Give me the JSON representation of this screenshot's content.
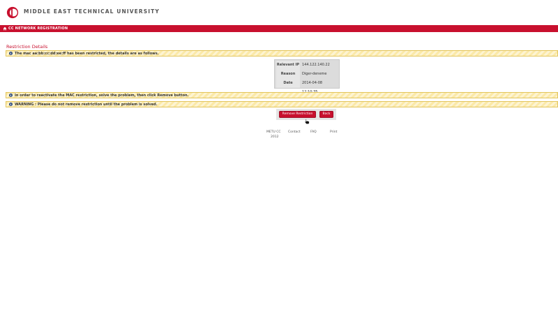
{
  "header": {
    "university_name": "MIDDLE EAST TECHNICAL UNIVERSITY",
    "logo_icon": "metu-logo-icon"
  },
  "navbar": {
    "title": "CC NETWORK REGISTRATION",
    "icon": "home-icon",
    "color": "#c8102e"
  },
  "section": {
    "title": "Restriction Details"
  },
  "notices": {
    "restricted": "The mac aa:bb:cc:dd:ee:ff has been restricted, the details are as follows.",
    "reactivate": "In order to reactivate the MAC restriction, solve the problem, then click Remove button.",
    "warning": "WARNING : Please do not remove restriction until the problem is solved."
  },
  "details": {
    "rows": [
      {
        "label": "Relevant IP",
        "value": "144.122.140.22"
      },
      {
        "label": "Reason",
        "value": "Diger-deneme"
      },
      {
        "label": "Date",
        "value": "2014-04-08 12:10:35"
      }
    ]
  },
  "buttons": {
    "remove": "Remove Restriction",
    "back": "Back"
  },
  "footer": {
    "brand": "METU CC",
    "year": "2012",
    "contact": "Contact",
    "faq": "FAQ",
    "print": "Print"
  }
}
